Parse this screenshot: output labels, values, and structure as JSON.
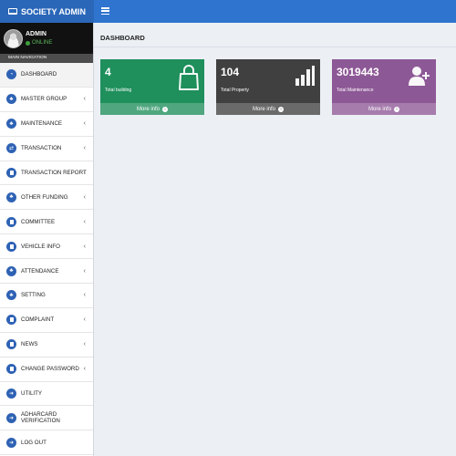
{
  "header": {
    "brand": "SOCIETY ADMIN",
    "page_title": "DASHBOARD"
  },
  "user": {
    "name": "ADMIN",
    "status": "ONLINE"
  },
  "sidebar": {
    "nav_header": "MAIN NAVIGATION",
    "items": [
      {
        "label": "DASHBOARD",
        "chevron": false
      },
      {
        "label": "MASTER GROUP",
        "chevron": true
      },
      {
        "label": "MAINTENANCE",
        "chevron": true
      },
      {
        "label": "TRANSACTION",
        "chevron": true
      },
      {
        "label": "TRANSACTION REPORT",
        "chevron": true
      },
      {
        "label": "OTHER FUNDING",
        "chevron": true
      },
      {
        "label": "COMMITTEE",
        "chevron": true
      },
      {
        "label": "VEHICLE INFO",
        "chevron": true
      },
      {
        "label": "ATTENDANCE",
        "chevron": true
      },
      {
        "label": "SETTING",
        "chevron": true
      },
      {
        "label": "COMPLAINT",
        "chevron": true
      },
      {
        "label": "NEWS",
        "chevron": true
      },
      {
        "label": "CHANGE PASSWORD",
        "chevron": true
      },
      {
        "label": "UTILITY",
        "chevron": false
      },
      {
        "label": "ADHARCARD VERIFICATION",
        "chevron": false
      },
      {
        "label": "LOG OUT",
        "chevron": false
      }
    ]
  },
  "stats": [
    {
      "value": "4",
      "label": "Total building",
      "link": "More info",
      "icon": "shopping-bag-icon",
      "color": "#1f8f5c"
    },
    {
      "value": "104",
      "label": "Total Property",
      "link": "More info",
      "icon": "bar-chart-icon",
      "color": "#404040"
    },
    {
      "value": "3019443",
      "label": "Total Maintenance",
      "link": "More info",
      "icon": "user-plus-icon",
      "color": "#8d5896"
    }
  ]
}
